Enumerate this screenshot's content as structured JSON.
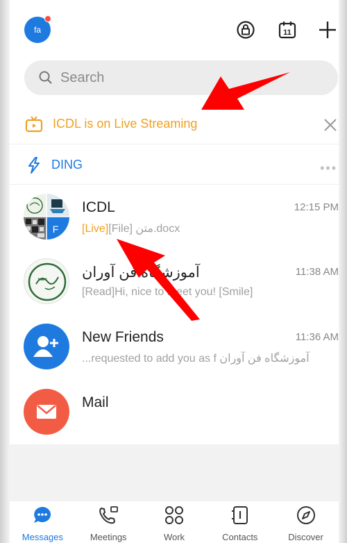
{
  "header": {
    "avatar_initials": "fa",
    "calendar_day": "11"
  },
  "search": {
    "placeholder": "Search"
  },
  "live_banner": {
    "text": "ICDL is on Live Streaming"
  },
  "ding": {
    "label": "DING",
    "more": "•••"
  },
  "conversations": [
    {
      "name": "ICDL",
      "time": "12:15 PM",
      "tag_live": "[Live]",
      "preview": "[File] متن.docx",
      "avatar_badge": "F"
    },
    {
      "name": "آموزشگاه فن آوران",
      "time": "11:38 AM",
      "preview": "[Read]Hi, nice to meet you! [Smile]"
    },
    {
      "name": "New Friends",
      "time": "11:36 AM",
      "preview": "آموزشگاه فن آوران requested to add you as f..."
    },
    {
      "name": "Mail"
    }
  ],
  "tabs": [
    {
      "label": "Messages"
    },
    {
      "label": "Meetings"
    },
    {
      "label": "Work"
    },
    {
      "label": "Contacts"
    },
    {
      "label": "Discover"
    }
  ],
  "colors": {
    "accent": "#1f7ae0",
    "live": "#f0a020",
    "annotation_arrow": "#ff0000",
    "mail": "#f25c45"
  }
}
